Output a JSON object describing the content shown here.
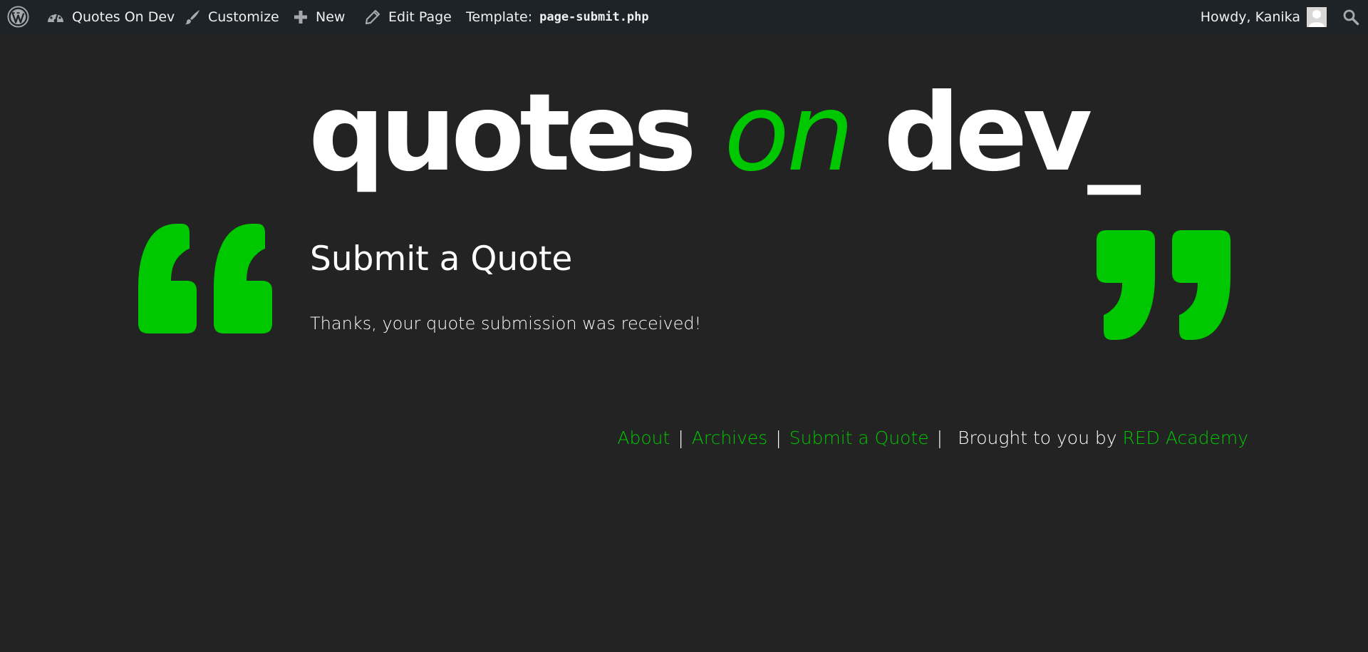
{
  "adminbar": {
    "wp_logo_icon": "wordpress-logo-icon",
    "site_name": "Quotes On Dev",
    "customize": "Customize",
    "new": "New",
    "edit_page": "Edit Page",
    "template_label": "Template:",
    "template_file": "page-submit.php",
    "howdy": "Howdy, Kanika",
    "search_icon": "search-icon"
  },
  "site": {
    "title_part1": "quotes",
    "title_part2": "on",
    "title_part3": "dev_"
  },
  "page": {
    "title": "Submit a Quote",
    "message": "Thanks, your quote submission was received!"
  },
  "footer": {
    "about": "About",
    "archives": "Archives",
    "submit": "Submit a Quote",
    "separator": "|",
    "credit_text": "Brought to you by",
    "credit_link": "RED Academy"
  },
  "colors": {
    "background": "#232323",
    "accent": "#00c800",
    "adminbar": "#1d2327",
    "text": "#ffffff"
  }
}
